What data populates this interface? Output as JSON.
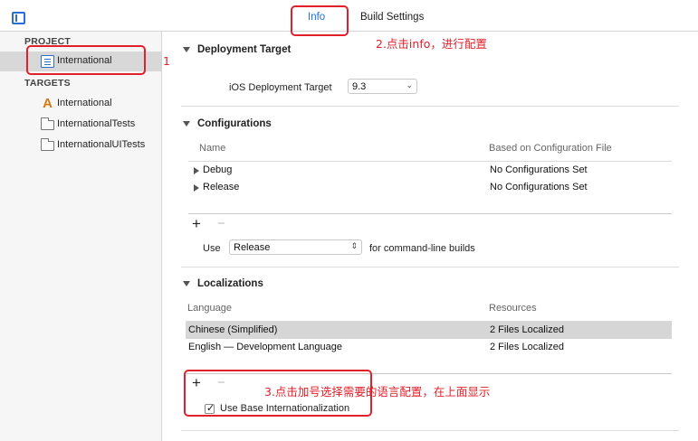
{
  "tabs": {
    "info": "Info",
    "build_settings": "Build Settings"
  },
  "sidebar": {
    "project_header": "PROJECT",
    "project_item": "International",
    "targets_header": "TARGETS",
    "targets": [
      "International",
      "InternationalTests",
      "InternationalUITests"
    ]
  },
  "deployment": {
    "title": "Deployment Target",
    "ios_label": "iOS Deployment Target",
    "ios_value": "9.3"
  },
  "configurations": {
    "title": "Configurations",
    "col_name": "Name",
    "col_based": "Based on Configuration File",
    "rows": [
      {
        "name": "Debug",
        "based": "No Configurations Set"
      },
      {
        "name": "Release",
        "based": "No Configurations Set"
      }
    ],
    "use_label": "Use",
    "use_value": "Release",
    "use_suffix": "for command-line builds"
  },
  "localizations": {
    "title": "Localizations",
    "col_language": "Language",
    "col_resources": "Resources",
    "rows": [
      {
        "language": "Chinese (Simplified)",
        "resources": "2 Files Localized"
      },
      {
        "language": "English — Development Language",
        "resources": "2 Files Localized"
      }
    ],
    "base_checkbox": "Use Base Internationalization"
  },
  "controls": {
    "plus": "+",
    "minus": "−"
  },
  "annotations": {
    "step1": "1",
    "step2": "2.点击info，进行配置",
    "step3": "3.点击加号选择需要的语言配置，在上面显示"
  },
  "colors": {
    "accent": "#1d6fe0",
    "annotation": "#e0202a",
    "selection": "#d6d6d6"
  },
  "icons": {
    "sidebar_toggle": "sidebar-toggle-icon",
    "project": "project-file-icon",
    "app_target": "app-target-icon",
    "test_target": "folder-icon"
  }
}
